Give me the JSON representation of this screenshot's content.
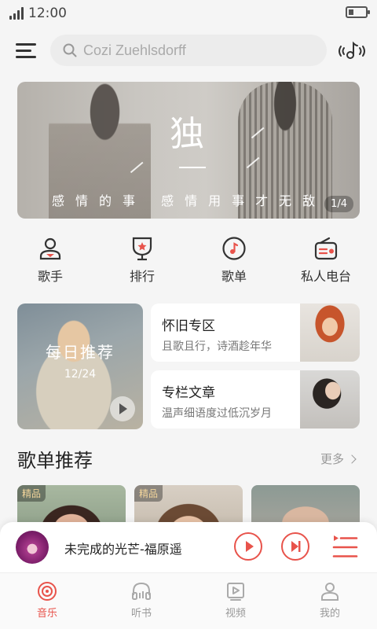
{
  "status": {
    "time": "12:00"
  },
  "header": {
    "search_placeholder": "Cozi Zuehlsdorff"
  },
  "banner": {
    "big_char": "独",
    "subtitle": "感情的事 感情用事才无敌",
    "page": "1/4"
  },
  "quick_nav": [
    {
      "label": "歌手",
      "icon": "singer-icon"
    },
    {
      "label": "排行",
      "icon": "ranking-icon"
    },
    {
      "label": "歌单",
      "icon": "playlist-icon"
    },
    {
      "label": "私人电台",
      "icon": "radio-icon"
    }
  ],
  "daily": {
    "title": "每日推荐",
    "date": "12/24"
  },
  "cards": [
    {
      "title": "怀旧专区",
      "subtitle": "且歌且行，诗酒趁年华"
    },
    {
      "title": "专栏文章",
      "subtitle": "温声细语度过低沉岁月"
    }
  ],
  "section": {
    "title": "歌单推荐",
    "more": "更多"
  },
  "recommend": [
    {
      "tag": "精品"
    },
    {
      "tag": "精品"
    },
    {
      "tag": ""
    }
  ],
  "player": {
    "song": "未完成的光芒-福原遥"
  },
  "tabs": [
    {
      "label": "音乐",
      "active": true
    },
    {
      "label": "听书",
      "active": false
    },
    {
      "label": "视频",
      "active": false
    },
    {
      "label": "我的",
      "active": false
    }
  ],
  "colors": {
    "accent": "#e8534b",
    "background": "#f5f5f5"
  }
}
